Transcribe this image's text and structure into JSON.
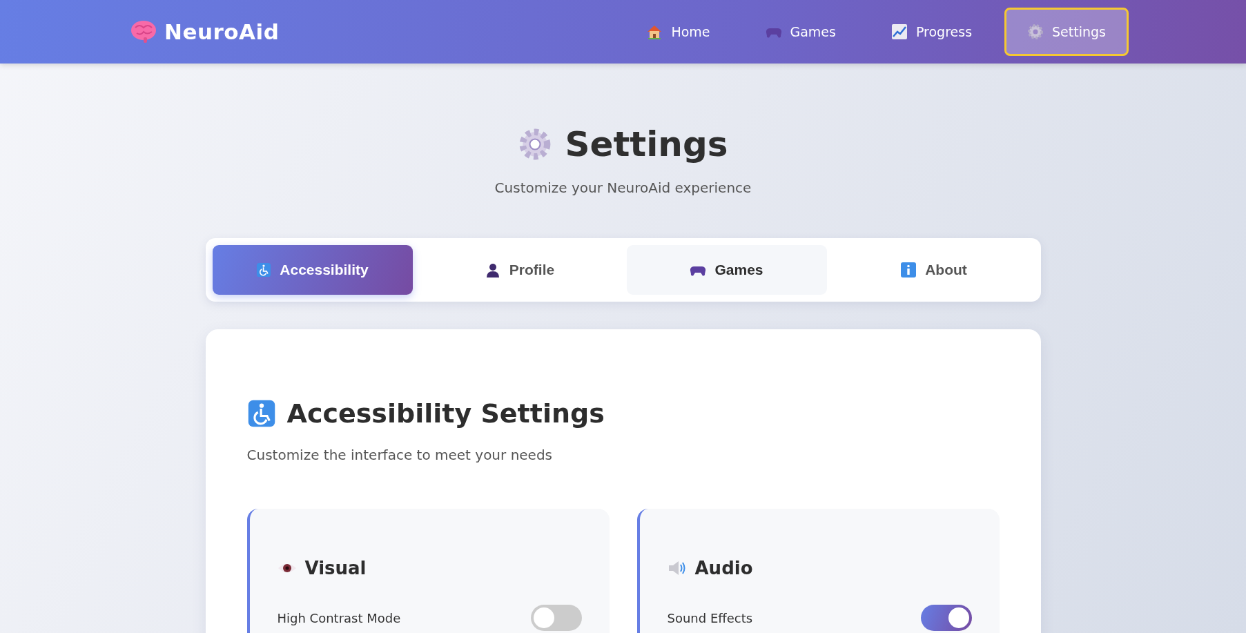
{
  "brand": {
    "name": "NeuroAid"
  },
  "nav": [
    {
      "label": "Home",
      "kind": "home",
      "selected": false
    },
    {
      "label": "Games",
      "kind": "gamepad",
      "selected": false
    },
    {
      "label": "Progress",
      "kind": "chart",
      "selected": false
    },
    {
      "label": "Settings",
      "kind": "gear",
      "selected": true
    }
  ],
  "page": {
    "title": "Settings",
    "subtitle": "Customize your NeuroAid experience"
  },
  "tabs": [
    {
      "label": "Accessibility",
      "kind": "wheelchair",
      "selected": true,
      "hovered": false
    },
    {
      "label": "Profile",
      "kind": "person",
      "selected": false,
      "hovered": false
    },
    {
      "label": "Games",
      "kind": "gamepad",
      "selected": false,
      "hovered": true
    },
    {
      "label": "About",
      "kind": "info",
      "selected": false,
      "hovered": false
    }
  ],
  "section": {
    "title": "Accessibility Settings",
    "kind": "wheelchair",
    "description": "Customize the interface to meet your needs"
  },
  "groups": [
    {
      "title": "Visual",
      "kind": "eye",
      "settings": [
        {
          "label": "High Contrast Mode",
          "on": false
        }
      ]
    },
    {
      "title": "Audio",
      "kind": "speaker",
      "settings": [
        {
          "label": "Sound Effects",
          "on": true
        }
      ]
    }
  ]
}
